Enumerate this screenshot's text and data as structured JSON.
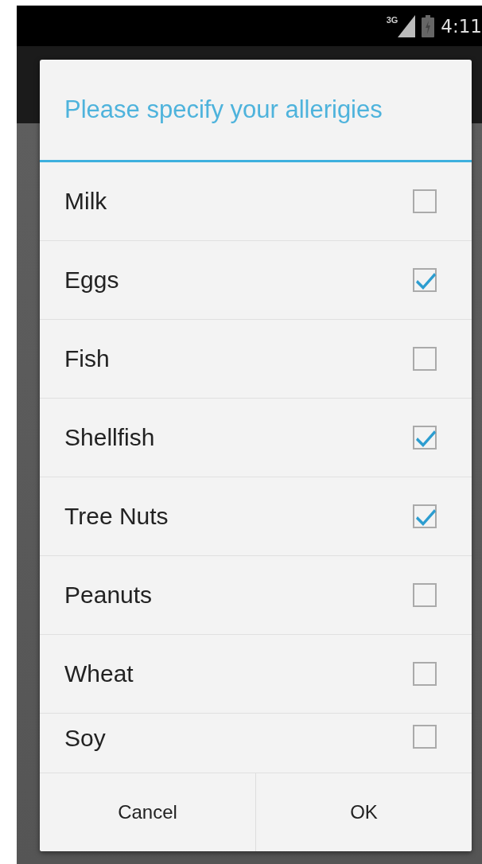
{
  "status_bar": {
    "network": "3G",
    "time": "4:11"
  },
  "dialog": {
    "title": "Please specify your allerigies",
    "items": [
      {
        "label": "Milk",
        "checked": false
      },
      {
        "label": "Eggs",
        "checked": true
      },
      {
        "label": "Fish",
        "checked": false
      },
      {
        "label": "Shellfish",
        "checked": true
      },
      {
        "label": "Tree Nuts",
        "checked": true
      },
      {
        "label": "Peanuts",
        "checked": false
      },
      {
        "label": "Wheat",
        "checked": false
      },
      {
        "label": "Soy",
        "checked": false
      }
    ],
    "buttons": [
      "Cancel",
      "OK"
    ]
  }
}
